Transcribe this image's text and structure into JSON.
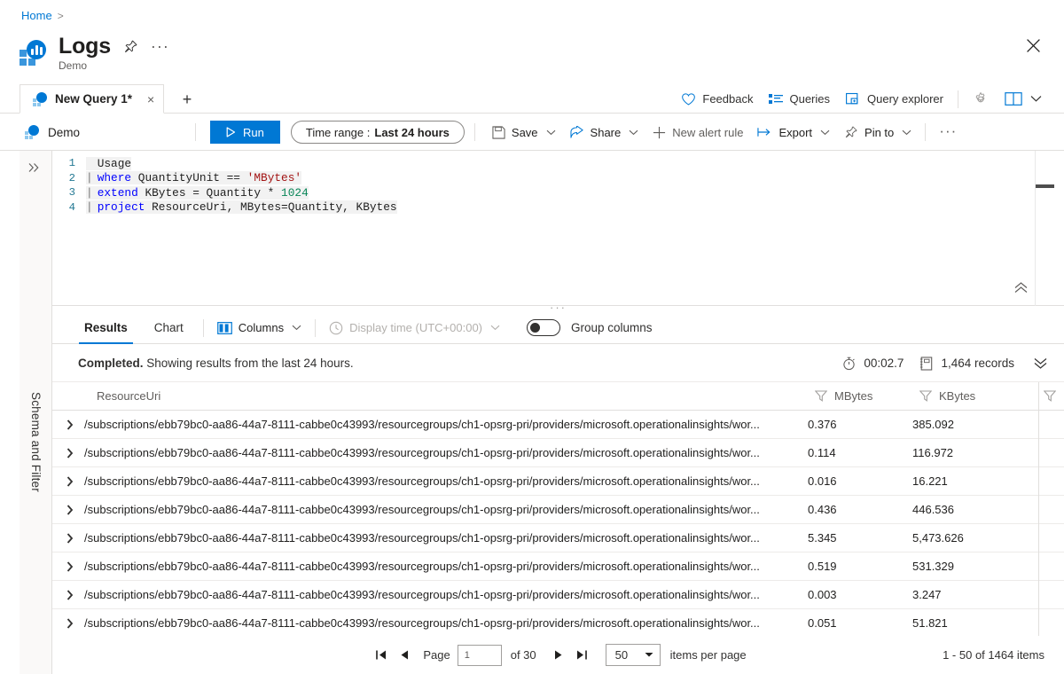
{
  "breadcrumb": {
    "home": "Home",
    "separator": ">"
  },
  "header": {
    "title": "Logs",
    "subtitle": "Demo",
    "pin_icon": "pin-icon",
    "more_icon": "ellipsis-icon",
    "close_icon": "close-icon"
  },
  "tabs": {
    "query_tab": {
      "label": "New Query 1*",
      "close": "×",
      "icon": "log-analytics-icon"
    },
    "add_tab": "+"
  },
  "header_actions": [
    {
      "label": "Feedback",
      "icon": "heart-icon"
    },
    {
      "label": "Queries",
      "icon": "list-icon"
    },
    {
      "label": "Query explorer",
      "icon": "window-icon"
    }
  ],
  "header_action_icons": {
    "settings": "gear-icon",
    "book": "book-icon",
    "chevron": "chevron-down-icon"
  },
  "commandbar": {
    "scope": "Demo",
    "scope_icon": "log-analytics-icon",
    "run": "Run",
    "run_icon": "play-icon",
    "timerange_label": "Time range :",
    "timerange_value": "Last 24 hours",
    "items": [
      {
        "label": "Save",
        "icon": "save-icon",
        "caret": true
      },
      {
        "label": "Share",
        "icon": "share-icon",
        "caret": true
      },
      {
        "label": "New alert rule",
        "icon": "plus-icon",
        "caret": false
      },
      {
        "label": "Export",
        "icon": "export-icon",
        "caret": true
      },
      {
        "label": "Pin to",
        "icon": "pin-icon",
        "caret": true
      }
    ],
    "more": "···"
  },
  "rail": {
    "label": "Schema and Filter",
    "expand_icon": "chevron-double-right-icon"
  },
  "editor": {
    "collapse_icon": "chevron-double-up-icon",
    "lines": [
      {
        "n": "1",
        "pipe": "",
        "tokens": [
          {
            "t": "Usage",
            "c": "plain"
          }
        ]
      },
      {
        "n": "2",
        "pipe": "|",
        "tokens": [
          {
            "t": "where",
            "c": "kw"
          },
          {
            "t": " QuantityUnit == ",
            "c": "plain"
          },
          {
            "t": "'MBytes'",
            "c": "str"
          }
        ]
      },
      {
        "n": "3",
        "pipe": "|",
        "tokens": [
          {
            "t": "extend",
            "c": "kw"
          },
          {
            "t": " KBytes = Quantity * ",
            "c": "plain"
          },
          {
            "t": "1024",
            "c": "num"
          }
        ]
      },
      {
        "n": "4",
        "pipe": "|",
        "tokens": [
          {
            "t": "project",
            "c": "kw"
          },
          {
            "t": " ResourceUri, MBytes=Quantity, KBytes",
            "c": "plain"
          }
        ]
      }
    ]
  },
  "results": {
    "tabs": [
      {
        "label": "Results",
        "active": true
      },
      {
        "label": "Chart",
        "active": false
      }
    ],
    "columns_button": {
      "label": "Columns",
      "icon": "columns-icon"
    },
    "display_time": {
      "label": "Display time (UTC+00:00)",
      "icon": "clock-icon",
      "disabled": true
    },
    "group_columns": {
      "label": "Group columns",
      "on": false
    },
    "status_text_bold": "Completed.",
    "status_text": " Showing results from the last 24 hours.",
    "elapsed": "00:02.7",
    "elapsed_icon": "stopwatch-icon",
    "records": "1,464 records",
    "records_icon": "records-icon",
    "expand_icon": "chevron-double-down-icon"
  },
  "table": {
    "headers": [
      {
        "key": "ResourceUri",
        "label": "ResourceUri",
        "filter_icon": "filter-icon"
      },
      {
        "key": "MBytes",
        "label": "MBytes",
        "filter_icon": "filter-icon"
      },
      {
        "key": "KBytes",
        "label": "KBytes",
        "filter_icon": "filter-icon"
      }
    ],
    "expand_icon": "chevron-right-icon",
    "rows": [
      {
        "uri": "/subscriptions/ebb79bc0-aa86-44a7-8111-cabbe0c43993/resourcegroups/ch1-opsrg-pri/providers/microsoft.operationalinsights/wor...",
        "mbytes": "0.376",
        "kbytes": "385.092"
      },
      {
        "uri": "/subscriptions/ebb79bc0-aa86-44a7-8111-cabbe0c43993/resourcegroups/ch1-opsrg-pri/providers/microsoft.operationalinsights/wor...",
        "mbytes": "0.114",
        "kbytes": "116.972"
      },
      {
        "uri": "/subscriptions/ebb79bc0-aa86-44a7-8111-cabbe0c43993/resourcegroups/ch1-opsrg-pri/providers/microsoft.operationalinsights/wor...",
        "mbytes": "0.016",
        "kbytes": "16.221"
      },
      {
        "uri": "/subscriptions/ebb79bc0-aa86-44a7-8111-cabbe0c43993/resourcegroups/ch1-opsrg-pri/providers/microsoft.operationalinsights/wor...",
        "mbytes": "0.436",
        "kbytes": "446.536"
      },
      {
        "uri": "/subscriptions/ebb79bc0-aa86-44a7-8111-cabbe0c43993/resourcegroups/ch1-opsrg-pri/providers/microsoft.operationalinsights/wor...",
        "mbytes": "5.345",
        "kbytes": "5,473.626"
      },
      {
        "uri": "/subscriptions/ebb79bc0-aa86-44a7-8111-cabbe0c43993/resourcegroups/ch1-opsrg-pri/providers/microsoft.operationalinsights/wor...",
        "mbytes": "0.519",
        "kbytes": "531.329"
      },
      {
        "uri": "/subscriptions/ebb79bc0-aa86-44a7-8111-cabbe0c43993/resourcegroups/ch1-opsrg-pri/providers/microsoft.operationalinsights/wor...",
        "mbytes": "0.003",
        "kbytes": "3.247"
      },
      {
        "uri": "/subscriptions/ebb79bc0-aa86-44a7-8111-cabbe0c43993/resourcegroups/ch1-opsrg-pri/providers/microsoft.operationalinsights/wor...",
        "mbytes": "0.051",
        "kbytes": "51.821"
      }
    ]
  },
  "pager": {
    "first_icon": "first-page-icon",
    "prev_icon": "previous-page-icon",
    "next_icon": "next-page-icon",
    "last_icon": "last-page-icon",
    "page_label": "Page",
    "page_value": "1",
    "of_label": "of 30",
    "page_size": "50",
    "items_per_page": "items per page",
    "range_text": "1 - 50 of 1464 items"
  },
  "colors": {
    "accent": "#0078d4",
    "link": "#0078d4",
    "border": "#e1dfdd",
    "text": "#201f1e",
    "muted": "#605e5c"
  }
}
